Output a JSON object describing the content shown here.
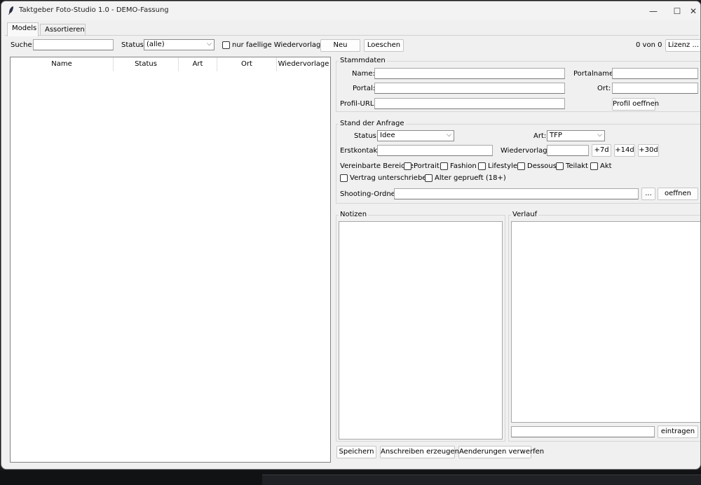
{
  "window": {
    "title": "Taktgeber Foto-Studio 1.0 - DEMO-Fassung",
    "controls": {
      "minimize": "—",
      "maximize": "☐",
      "close": "✕"
    }
  },
  "tabs": [
    {
      "label": "Models",
      "active": true
    },
    {
      "label": "Assortieren",
      "active": false
    }
  ],
  "toolbar": {
    "search_label": "Suche:",
    "search_value": "",
    "status_label": "Status:",
    "status_value": "(alle)",
    "due_checkbox_label": "nur faellige Wiedervorlagen",
    "new_button": "Neu",
    "delete_button": "Loeschen",
    "count_text": "0 von 0",
    "license_button": "Lizenz ..."
  },
  "table": {
    "columns": [
      "Name",
      "Status",
      "Art",
      "Ort",
      "Wiedervorlage"
    ],
    "rows": []
  },
  "stammdaten": {
    "title": "Stammdaten",
    "name_label": "Name:",
    "name_value": "",
    "portal_label": "Portal:",
    "portal_value": "",
    "profil_url_label": "Profil-URL:",
    "profil_url_value": "",
    "portalname_label": "Portalname:",
    "portalname_value": "",
    "ort_label": "Ort:",
    "ort_value": "",
    "open_profile_button": "Profil oeffnen"
  },
  "anfrage": {
    "title": "Stand der Anfrage",
    "status_label": "Status:",
    "status_value": "Idee",
    "art_label": "Art:",
    "art_value": "TFP",
    "erstkontakt_label": "Erstkontakt:",
    "erstkontakt_value": "",
    "wiedervorlage_label": "Wiedervorlage:",
    "wiedervorlage_value": "",
    "plus7_button": "+7d",
    "plus14_button": "+14d",
    "plus30_button": "+30d",
    "bereiche_label": "Vereinbarte Bereiche:",
    "bereiche": [
      "Portrait",
      "Fashion",
      "Lifestyle",
      "Dessous",
      "Teilakt",
      "Akt"
    ],
    "vertrag_label": "Vertrag unterschrieben",
    "alter_label": "Alter geprueft (18+)",
    "ordner_label": "Shooting-Ordner:",
    "ordner_value": "",
    "browse_button": "...",
    "open_folder_button": "oeffnen"
  },
  "notizen": {
    "title": "Notizen"
  },
  "verlauf": {
    "title": "Verlauf",
    "entry_value": "",
    "add_button": "eintragen"
  },
  "footer": {
    "save_button": "Speichern",
    "letter_button": "Anschreiben erzeugen ...",
    "discard_button": "Aenderungen verwerfen"
  }
}
